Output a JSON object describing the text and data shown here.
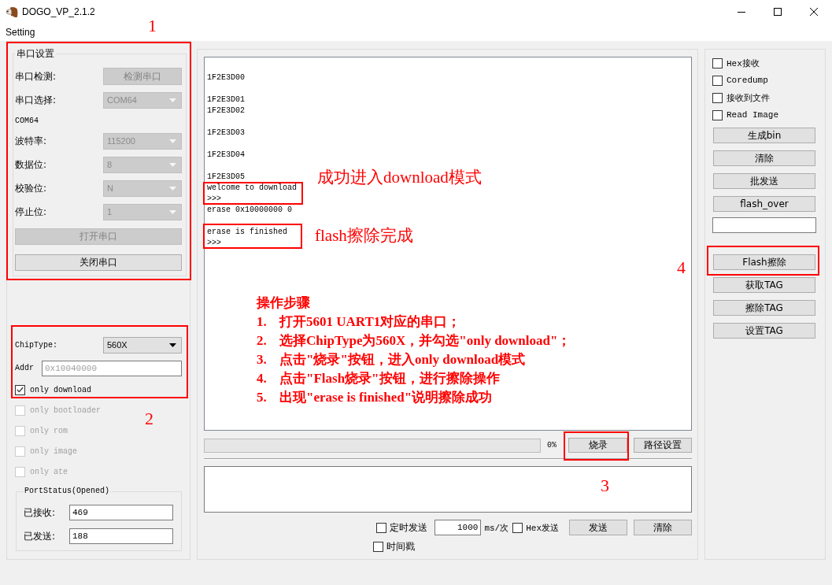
{
  "window": {
    "title": "DOGO_VP_2.1.2"
  },
  "menu": [
    {
      "label": "Setting"
    }
  ],
  "serial_settings": {
    "title": "串口设置",
    "rows": [
      {
        "kind": "button",
        "label": "串口检测:",
        "value": "检测串口",
        "disabled": true
      },
      {
        "kind": "combo",
        "label": "串口选择:",
        "value": "COM64",
        "disabled": true
      },
      {
        "kind": "text",
        "value": "COM64"
      },
      {
        "kind": "combo",
        "label": "波特率:",
        "value": "115200",
        "disabled": true
      },
      {
        "kind": "combo",
        "label": "数据位:",
        "value": "8",
        "disabled": true
      },
      {
        "kind": "combo",
        "label": "校验位:",
        "value": "N",
        "disabled": true
      },
      {
        "kind": "combo",
        "label": "停止位:",
        "value": "1",
        "disabled": true
      }
    ],
    "buttons": [
      {
        "label": "打开串口",
        "disabled": true
      },
      {
        "label": "关闭串口",
        "disabled": false
      }
    ]
  },
  "chip": {
    "type": {
      "label": "ChipType:",
      "value": "560X",
      "disabled": false
    },
    "addr": {
      "label": "Addr",
      "placeholder": "0x10040000"
    },
    "options": [
      {
        "label": "only download",
        "checked": true,
        "disabled": false
      },
      {
        "label": "only bootloader",
        "checked": false,
        "disabled": true
      },
      {
        "label": "only rom",
        "checked": false,
        "disabled": true
      },
      {
        "label": "only image",
        "checked": false,
        "disabled": true
      },
      {
        "label": "only ate",
        "checked": false,
        "disabled": true
      }
    ]
  },
  "port_status": {
    "title": "PortStatus(Opened)",
    "fields": [
      {
        "label": "已接收:",
        "value": "469"
      },
      {
        "label": "已发送:",
        "value": "188"
      }
    ]
  },
  "log": {
    "blocks": [
      {
        "lines": [
          "1F2E3D00"
        ]
      },
      {
        "lines": [
          "1F2E3D01",
          "1F2E3D02"
        ]
      },
      {
        "lines": [
          "1F2E3D03"
        ]
      },
      {
        "lines": [
          "1F2E3D04"
        ]
      },
      {
        "lines": [
          "1F2E3D05",
          "welcome to download",
          ">>>",
          "erase 0x10000000 0"
        ]
      },
      {
        "lines": [
          "erase is finished",
          ">>>"
        ]
      }
    ]
  },
  "burn": {
    "progress": {
      "level": 0,
      "reading": "0%"
    },
    "buttons": [
      {
        "label": "烧录"
      },
      {
        "label": "路径设置"
      }
    ]
  },
  "send": {
    "timed": {
      "label": "定时发送",
      "checked": false
    },
    "interval": {
      "value": "1000",
      "unit": "ms/次"
    },
    "hex": {
      "label": "Hex发送",
      "checked": false
    },
    "buttons": [
      {
        "label": "发送"
      },
      {
        "label": "清除"
      }
    ],
    "timestamp": {
      "label": "时间戳",
      "checked": false
    }
  },
  "tools": {
    "options": [
      {
        "label": "Hex接收",
        "checked": false
      },
      {
        "label": "Coredump",
        "checked": false
      },
      {
        "label": "接收到文件",
        "checked": false
      },
      {
        "label": "Read Image",
        "checked": false
      }
    ],
    "buttons": [
      {
        "label": "生成bin"
      },
      {
        "label": "清除"
      },
      {
        "label": "批发送"
      },
      {
        "label": "flash_over"
      }
    ],
    "tag_buttons": [
      {
        "label": "Flash擦除"
      },
      {
        "label": "获取TAG"
      },
      {
        "label": "擦除TAG"
      },
      {
        "label": "设置TAG"
      }
    ]
  },
  "annotations": {
    "callouts": [
      {
        "label": "1"
      },
      {
        "label": "2"
      },
      {
        "label": "3"
      },
      {
        "label": "4"
      }
    ],
    "notes": [
      {
        "text": "成功进入download模式"
      },
      {
        "text": "flash擦除完成"
      }
    ],
    "steps": {
      "title": "操作步骤",
      "items": [
        {
          "number": "1.",
          "text": "打开5601 UART1对应的串口；"
        },
        {
          "number": "2.",
          "text": "选择ChipType为560X，并勾选\"only download\"；"
        },
        {
          "number": "3.",
          "text": "点击\"烧录\"按钮，进入only download模式"
        },
        {
          "number": "4.",
          "text": "点击\"Flash烧录\"按钮，进行擦除操作"
        },
        {
          "number": "5.",
          "text": "出现\"erase is finished\"说明擦除成功"
        }
      ]
    }
  }
}
